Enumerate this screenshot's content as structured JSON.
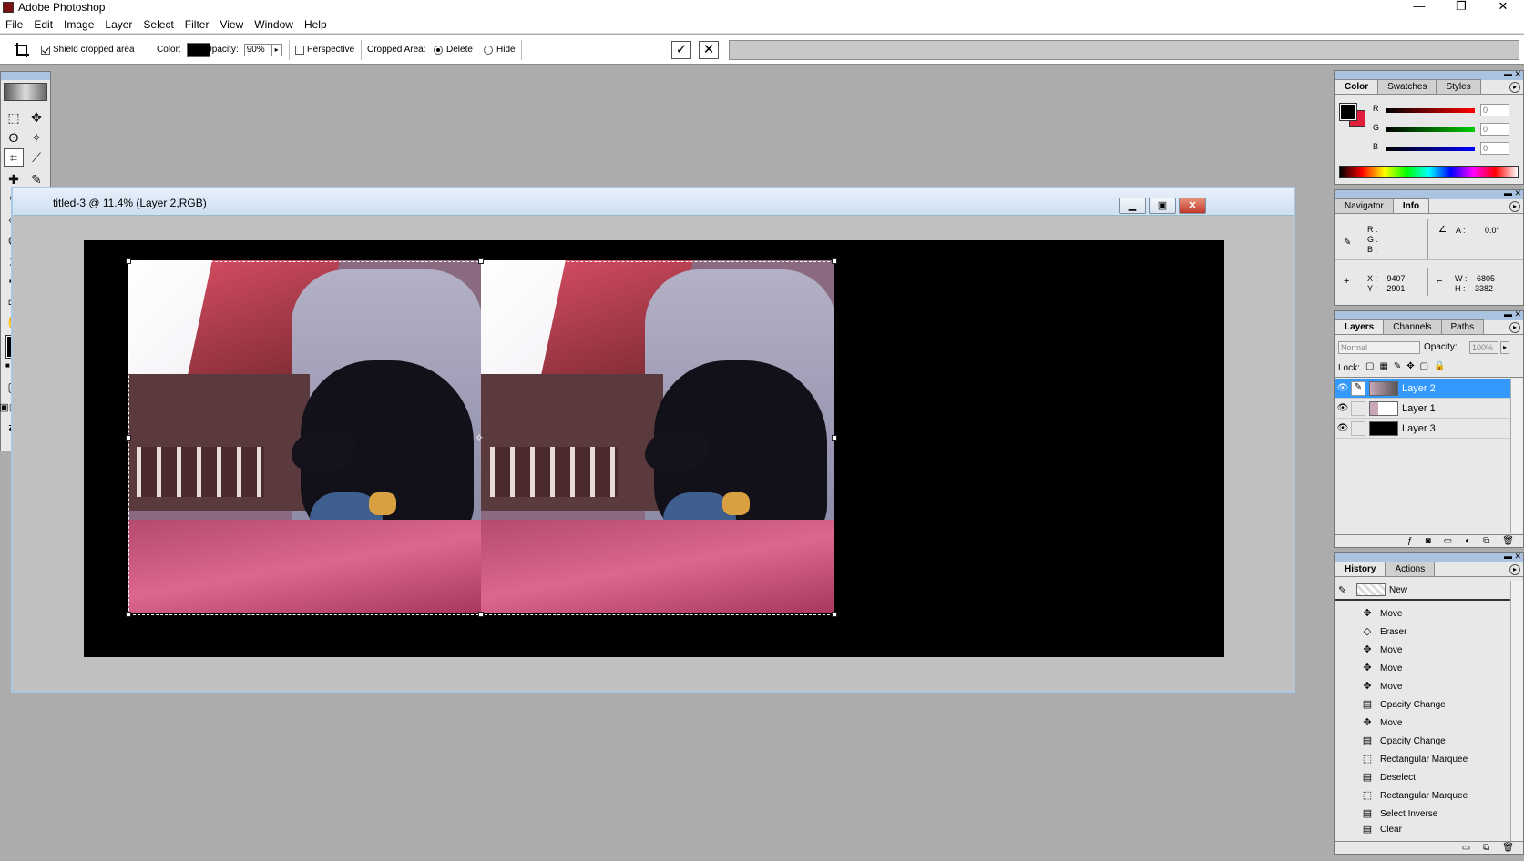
{
  "app": {
    "title": "Adobe Photoshop",
    "min": "—",
    "max": "❐",
    "close": "✕"
  },
  "menu": [
    "File",
    "Edit",
    "Image",
    "Layer",
    "Select",
    "Filter",
    "View",
    "Window",
    "Help"
  ],
  "options": {
    "shield_label": "Shield cropped area",
    "color_label": "Color:",
    "opacity_label": "Opacity:",
    "opacity_value": "90%",
    "perspective_label": "Perspective",
    "cropped_area_label": "Cropped Area:",
    "delete_label": "Delete",
    "hide_label": "Hide",
    "commit": "✓",
    "cancel": "✕"
  },
  "document": {
    "title": "titled-3 @ 11.4% (Layer 2,RGB)",
    "min": "▁",
    "max": "▣",
    "close": "✕"
  },
  "color_panel": {
    "tabs": [
      "Color",
      "Swatches",
      "Styles"
    ],
    "r_label": "R",
    "g_label": "G",
    "b_label": "B",
    "r": "0",
    "g": "0",
    "b": "0",
    "fg": "#000000",
    "bg": "#e01e3c"
  },
  "info_panel": {
    "tabs": [
      "Navigator",
      "Info"
    ],
    "r": "R :",
    "g": "G :",
    "b": "B :",
    "a_label": "A :",
    "a_value": "0.0°",
    "x_label": "X :",
    "x_value": "9407",
    "y_label": "Y :",
    "y_value": "2901",
    "w_label": "W :",
    "w_value": "6805",
    "h_label": "H :",
    "h_value": "3382"
  },
  "layers_panel": {
    "tabs": [
      "Layers",
      "Channels",
      "Paths"
    ],
    "blend": "Normal",
    "opacity_label": "Opacity:",
    "opacity": "100%",
    "lock_label": "Lock:",
    "layers": [
      {
        "name": "Layer 2",
        "active": true
      },
      {
        "name": "Layer 1",
        "active": false
      },
      {
        "name": "Layer 3",
        "active": false
      }
    ]
  },
  "history_panel": {
    "tabs": [
      "History",
      "Actions"
    ],
    "snapshot": "New",
    "items": [
      "Move",
      "Eraser",
      "Move",
      "Move",
      "Move",
      "Opacity Change",
      "Move",
      "Opacity Change",
      "Rectangular Marquee",
      "Deselect",
      "Rectangular Marquee",
      "Select Inverse",
      "Clear"
    ]
  }
}
